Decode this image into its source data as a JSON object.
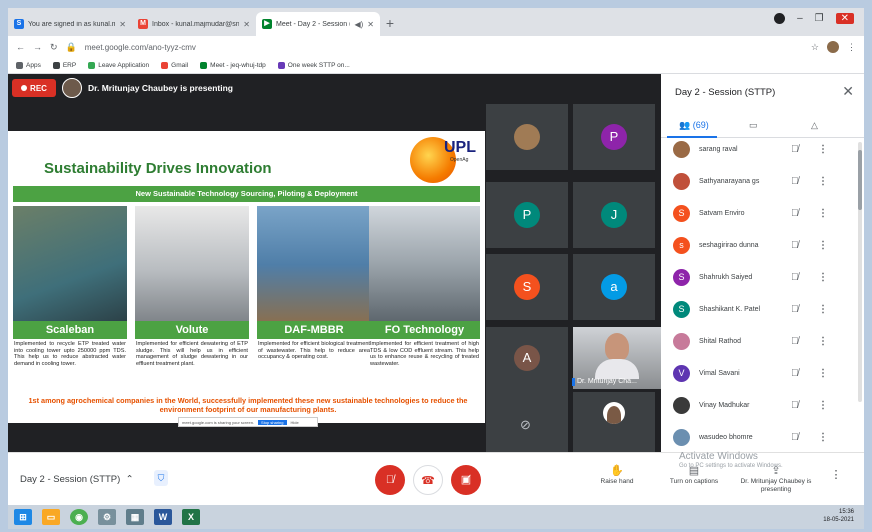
{
  "browser": {
    "tabs": [
      {
        "label": "You are signed in as kunal.m",
        "fav": "S",
        "favcolor": "#1a73e8"
      },
      {
        "label": "Inbox - kunal.majmudar@snct.in",
        "fav": "M",
        "favcolor": "#ea4335"
      },
      {
        "label": "Meet - Day 2 - Session (STT",
        "fav": "▶",
        "favcolor": "#00832d"
      }
    ],
    "url": "meet.google.com/ano-tyyz-cmv",
    "bookmarks": [
      "Apps",
      "ERP",
      "Leave Application",
      "Gmail",
      "Meet - jeq-whuj-tdp",
      "One week STTP on..."
    ]
  },
  "meet": {
    "rec": "REC",
    "presenter_text": "Dr. Mritunjay Chaubey is presenting",
    "meeting_name": "Day 2 - Session (STTP)",
    "panel": {
      "title": "Day 2 - Session (STTP)",
      "count": "(69)",
      "participants": [
        {
          "name": "sarang raval",
          "initial": "",
          "color": "#9a6a45"
        },
        {
          "name": "Sathyanarayana gs",
          "initial": "",
          "color": "#c0503a"
        },
        {
          "name": "Satvam Enviro",
          "initial": "S",
          "color": "#f4511e"
        },
        {
          "name": "seshagirirao dunna",
          "initial": "s",
          "color": "#f4511e"
        },
        {
          "name": "Shahrukh Saiyed",
          "initial": "S",
          "color": "#8e24aa"
        },
        {
          "name": "Shashikant K. Patel",
          "initial": "S",
          "color": "#00897b"
        },
        {
          "name": "Shital Rathod",
          "initial": "",
          "color": "#c77a9a"
        },
        {
          "name": "Vimal Savani",
          "initial": "V",
          "color": "#5e35b1"
        },
        {
          "name": "Vinay Madhukar",
          "initial": "",
          "color": "#3a3a3a"
        },
        {
          "name": "wasudeo bhomre",
          "initial": "",
          "color": "#6b8fb0"
        }
      ]
    },
    "tiles": [
      {
        "letter": "",
        "color": "#a07b55"
      },
      {
        "letter": "P",
        "color": "#8e24aa"
      },
      {
        "letter": "P",
        "color": "#00897b"
      },
      {
        "letter": "J",
        "color": "#00897b"
      },
      {
        "letter": "S",
        "color": "#f4511e"
      },
      {
        "letter": "a",
        "color": "#039be5"
      },
      {
        "letter": "A",
        "color": "#795548"
      }
    ],
    "video_name": "Dr. Mritunjay Cha...",
    "controls": {
      "raise_hand": "Raise hand",
      "captions": "Turn on captions",
      "presenting": "Dr. Mritunjay Chaubey is presenting"
    },
    "watermark": "Activate Windows",
    "watermark_sub": "Go to PC settings to activate Windows."
  },
  "slide": {
    "title": "Sustainability Drives Innovation",
    "logo": "UPL",
    "logo_sub": "OpenAg",
    "banner": "New Sustainable Technology Sourcing, Piloting & Deployment",
    "techs": [
      {
        "label": "Scaleban",
        "desc": "Implemented to recycle ETP treated water into cooling tower upto 250000 ppm TDS. This help us to reduce abstracted water demand in cooling tower."
      },
      {
        "label": "Volute",
        "desc": "Implemented for efficient dewatering of ETP sludge. This will help us in efficient management of sludge dewatering in our effluent treatment plant."
      },
      {
        "label": "DAF-MBBR",
        "desc": "Implemented for efficient biological treatment of wastewater. This help to reduce area occupancy & operating cost."
      },
      {
        "label": "FO Technology",
        "desc": "Implemented for efficient treatment of high TDS & low COD effluent stream. This help us to enhance reuse & recycling of treated wastewater."
      }
    ],
    "footer": "1st among agrochemical companies in the World, successfully implemented these new sustainable technologies to reduce the environment footprint of our manufacturing plants.",
    "share_text": "meet.google.com is sharing your screen.",
    "stop_sharing": "Stop sharing",
    "hide": "Hide"
  },
  "taskbar": {
    "time": "15:36",
    "date": "18-05-2021"
  }
}
